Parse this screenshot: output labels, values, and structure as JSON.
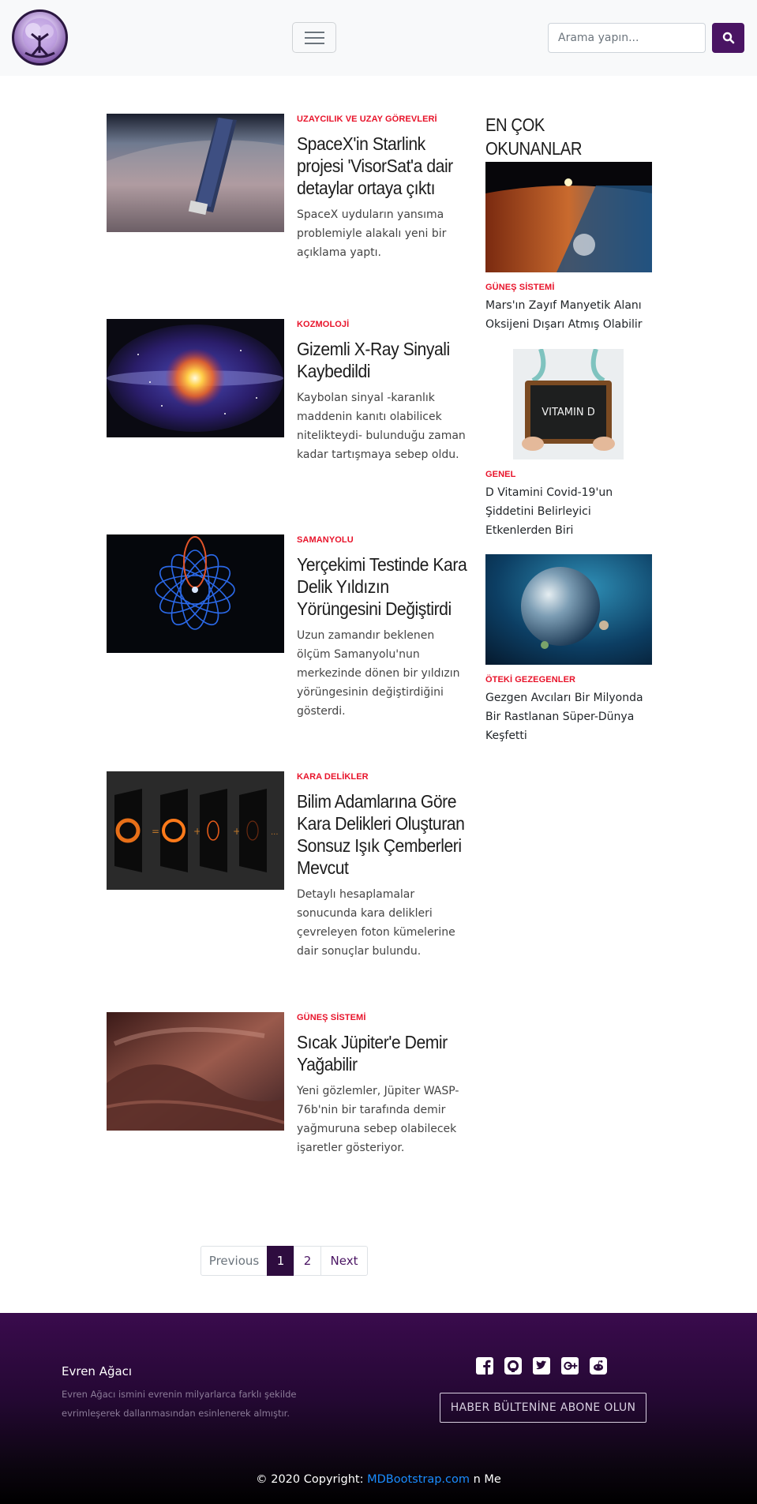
{
  "navbar": {
    "search_placeholder": "Arama yapın..."
  },
  "articles": [
    {
      "category": "UZAYCILIK VE UZAY GÖREVLERİ",
      "title": "SpaceX'in Starlink projesi 'VisorSat'a dair detaylar ortaya çıktı",
      "excerpt": "SpaceX uyduların yansıma problemiyle alakalı yeni bir açıklama yaptı."
    },
    {
      "category": "KOZMOLOJİ",
      "title": "Gizemli X-Ray Sinyali Kaybedildi",
      "excerpt": "Kaybolan sinyal -karanlık maddenin kanıtı olabilicek nitelikteydi- bulunduğu zaman kadar tartışmaya sebep oldu."
    },
    {
      "category": "SAMANYOLU",
      "title": "Yerçekimi Testinde Kara Delik Yıldızın Yörüngesini Değiştirdi",
      "excerpt": "Uzun zamandır beklenen ölçüm Samanyolu'nun merkezinde dönen bir yıldızın yörüngesinin değiştirdiğini gösterdi."
    },
    {
      "category": "KARA DELİKLER",
      "title": "Bilim Adamlarına Göre Kara Delikleri Oluşturan Sonsuz Işık Çemberleri Mevcut",
      "excerpt": "Detaylı hesaplamalar sonucunda kara delikleri çevreleyen foton kümelerine dair sonuçlar bulundu."
    },
    {
      "category": "GÜNEŞ SİSTEMİ",
      "title": "Sıcak Jüpiter'e Demir Yağabilir",
      "excerpt": "Yeni gözlemler, Jüpiter WASP-76b'nin bir tarafında demir yağmuruna sebep olabilecek işaretler gösteriyor."
    }
  ],
  "sidebar": {
    "title": "EN ÇOK OKUNANLAR",
    "items": [
      {
        "category": "GÜNEŞ SİSTEMİ",
        "title": "Mars'ın Zayıf Manyetik Alanı Oksijeni Dışarı Atmış Olabilir"
      },
      {
        "category": "GENEL",
        "title": "D Vitamini Covid-19'un Şiddetini Belirleyici Etkenlerden Biri",
        "image_text": "VITAMIN D"
      },
      {
        "category": "ÖTEKİ GEZEGENLER",
        "title": "Gezgen Avcıları Bir Milyonda Bir Rastlanan Süper-Dünya Keşfetti"
      }
    ]
  },
  "pagination": {
    "previous": "Previous",
    "pages": [
      "1",
      "2"
    ],
    "active_page": "1",
    "next": "Next"
  },
  "footer": {
    "brand": "Evren Ağacı",
    "description": "Evren Ağacı ismini evrenin milyarlarca farklı şekilde evrimleşerek dallanmasından esinlenerek almıştır.",
    "newsletter_button": "HABER BÜLTENİNE ABONE OLUN",
    "social_icons": [
      "facebook-icon",
      "github-icon",
      "twitter-icon",
      "google-plus-icon",
      "reddit-icon"
    ],
    "copyright_prefix": "© 2020 Copyright:",
    "copyright_link": "MDBootstrap.com",
    "copyright_suffix": "n Me"
  },
  "colors": {
    "brand_purple": "#4a1463",
    "category_red": "#e8132a",
    "active_page": "#2e0c3f",
    "link_blue": "#1a8cff"
  }
}
